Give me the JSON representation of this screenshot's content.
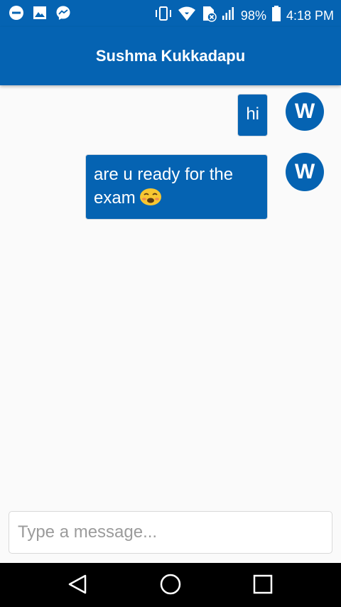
{
  "status_bar": {
    "battery": "98%",
    "time": "4:18 PM",
    "left_icons": [
      "minus-circle-icon",
      "image-icon",
      "messenger-icon"
    ],
    "right_icons": [
      "vibrate-icon",
      "wifi-icon",
      "no-sim-icon",
      "signal-icon",
      "battery-icon"
    ]
  },
  "header": {
    "title": "Sushma Kukkadapu"
  },
  "messages": [
    {
      "text": "hi",
      "avatar_letter": "W"
    },
    {
      "text": "are u ready for the exam",
      "emoji": "😩",
      "avatar_letter": "W"
    }
  ],
  "composer": {
    "placeholder": "Type a message..."
  },
  "nav_bar": {
    "buttons": [
      "back-icon",
      "home-icon",
      "recents-icon"
    ]
  },
  "colors": {
    "primary": "#0563b2",
    "background": "#fafafa"
  }
}
